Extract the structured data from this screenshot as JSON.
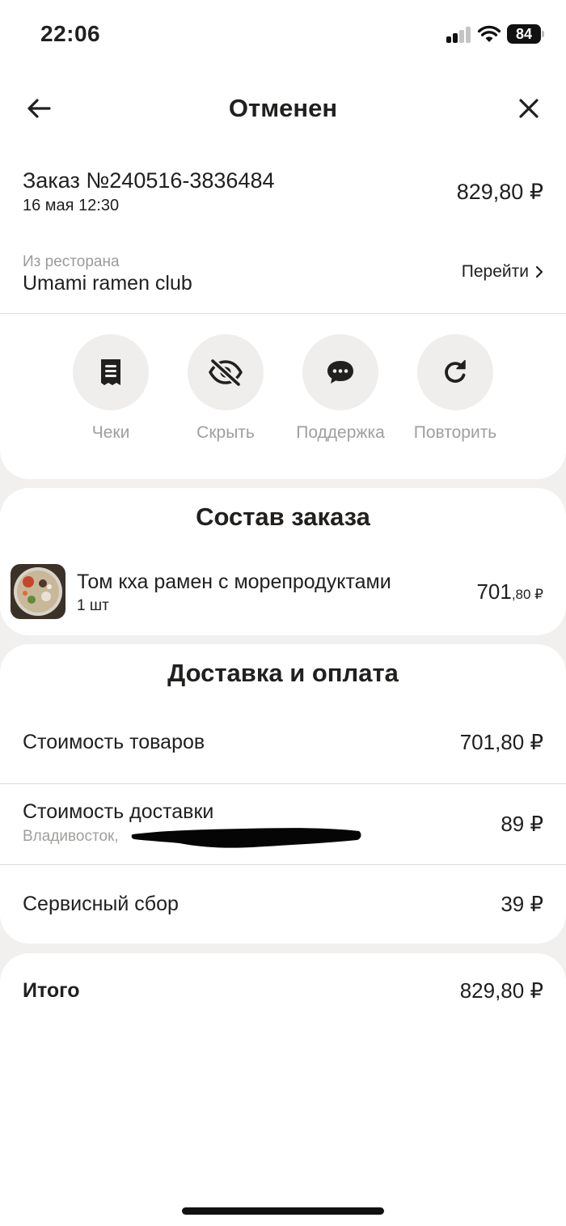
{
  "status_bar": {
    "time": "22:06",
    "battery": "84",
    "icons": [
      "signal-icon",
      "wifi-icon",
      "battery-icon"
    ]
  },
  "header": {
    "title": "Отменен",
    "back_icon": "arrow-left-icon",
    "close_icon": "close-icon"
  },
  "order": {
    "number": "Заказ №240516-3836484",
    "date": "16 мая 12:30",
    "total": "829,80 ₽"
  },
  "restaurant": {
    "caption": "Из ресторана",
    "name": "Umami ramen club",
    "go_label": "Перейти"
  },
  "actions": [
    {
      "label": "Чеки",
      "icon": "receipt-icon"
    },
    {
      "label": "Скрыть",
      "icon": "eye-off-icon"
    },
    {
      "label": "Поддержка",
      "icon": "chat-bubble-icon"
    },
    {
      "label": "Повторить",
      "icon": "refresh-icon"
    }
  ],
  "composition": {
    "title": "Состав заказа",
    "items": [
      {
        "name": "Том кха рамен с морепродуктами",
        "qty": "1 шт",
        "price_main": "701",
        "price_cents": ",80 ₽"
      }
    ]
  },
  "delivery": {
    "title": "Доставка и оплата",
    "rows": [
      {
        "label": "Стоимость товаров",
        "value": "701,80 ₽"
      },
      {
        "label": "Стоимость доставки",
        "sublabel": "Владивосток,",
        "value": "89 ₽"
      },
      {
        "label": "Сервисный сбор",
        "value": "39 ₽"
      }
    ]
  },
  "total": {
    "label": "Итого",
    "value": "829,80 ₽"
  },
  "colors": {
    "background": "#f1f0ef",
    "card": "#ffffff",
    "text": "#21201f",
    "muted": "#a09f9d",
    "action_bg": "#efeeed"
  }
}
